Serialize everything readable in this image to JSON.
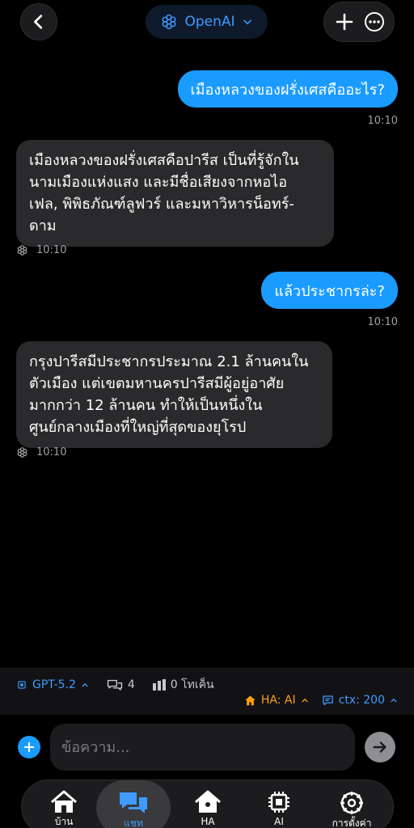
{
  "header": {
    "model_name": "OpenAI",
    "icons": [
      "back-icon",
      "openai-logo-icon",
      "chevron-down-icon",
      "plus-icon",
      "more-icon"
    ]
  },
  "messages": [
    {
      "role": "user",
      "text": "เมืองหลวงของฝรั่งเศสคืออะไร?",
      "time": "10:10"
    },
    {
      "role": "assistant",
      "lines": [
        "เมืองหลวงของฝรั่งเศสคือปารีส เป็นที่รู้จักใน",
        "นามเมืองแห่งแสง และมีชื่อเสียงจากหอไอ",
        "เฟล, พิพิธภัณฑ์ลูฟวร์ และมหาวิหารน็อทร์-",
        "ดาม"
      ],
      "time": "10:10"
    },
    {
      "role": "user",
      "text": "แล้วประชากรล่ะ?",
      "time": "10:10"
    },
    {
      "role": "assistant",
      "lines": [
        "กรุงปารีสมีประชากรประมาณ 2.1 ล้านคนใน",
        "ตัวเมือง แต่เขตมหานครปารีสมีผู้อยู่อาศัย",
        "มากกว่า 12 ล้านคน ทำให้เป็นหนึ่งใน",
        "ศูนย์กลางเมืองที่ใหญ่ที่สุดของยุโรป"
      ],
      "time": "10:10"
    }
  ],
  "status": {
    "model": "GPT-5.2",
    "conversations": "4",
    "tokens": "0 โทเค็น",
    "ha": "HA: AI",
    "ctx": "ctx: 200"
  },
  "composer": {
    "placeholder": "ข้อความ..."
  },
  "nav": {
    "items": [
      {
        "label": "บ้าน",
        "icon": "home-icon"
      },
      {
        "label": "แชท",
        "icon": "chat-icon",
        "active": true
      },
      {
        "label": "HA",
        "icon": "home-assistant-icon"
      },
      {
        "label": "AI",
        "icon": "chip-icon"
      },
      {
        "label": "การตั้งค่า",
        "icon": "settings-icon"
      }
    ]
  },
  "colors": {
    "accent": "#1a9bff",
    "orange": "#ff9f0a",
    "bubble_bot": "#2a2a2c",
    "background": "#000000"
  }
}
